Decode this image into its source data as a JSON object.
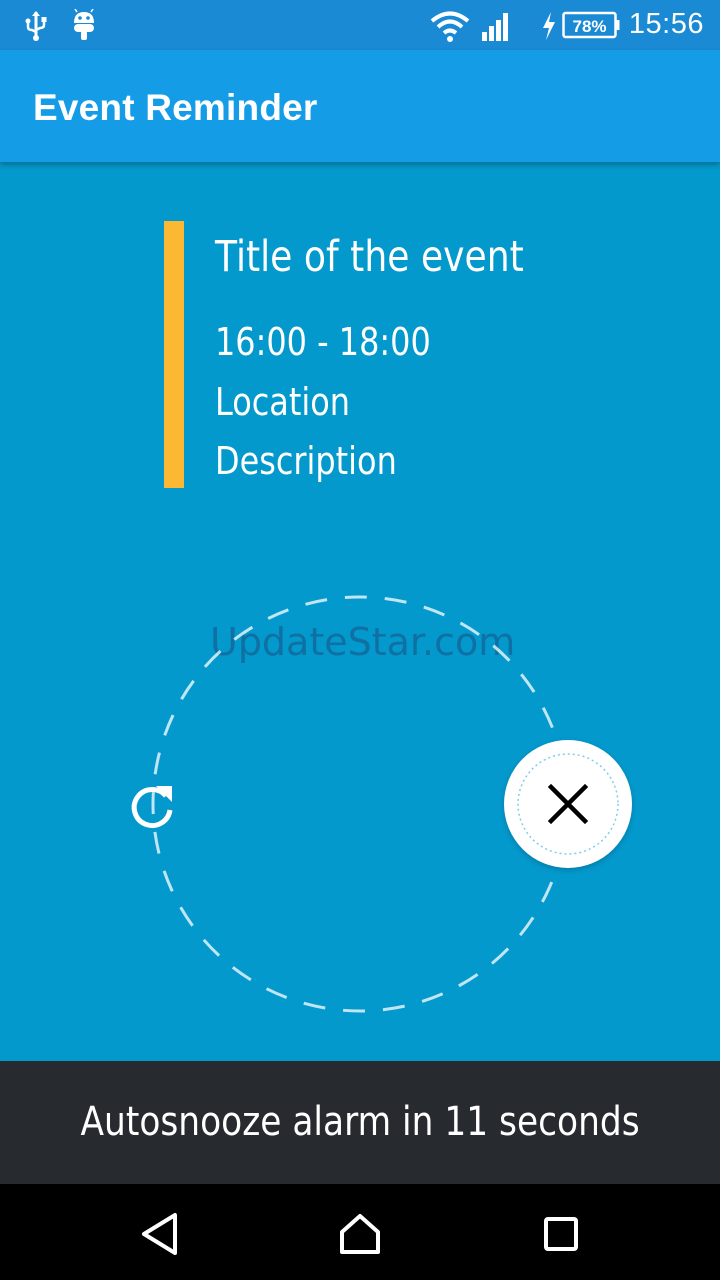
{
  "status_bar": {
    "time": "15:56",
    "battery": "78%",
    "icons": [
      "usb-icon",
      "android-debug-icon",
      "wifi-icon",
      "cell-signal-icon",
      "charging-icon",
      "battery-icon"
    ]
  },
  "app_bar": {
    "title": "Event Reminder"
  },
  "event": {
    "title": "Title of the event",
    "time": "16:00 - 18:00",
    "location": "Location",
    "description": "Description",
    "accent_color": "#fbb933"
  },
  "watermark": "UpdateStar.com",
  "dial": {
    "snooze_icon": "snooze-refresh-icon",
    "dismiss_icon": "close-icon"
  },
  "autosnooze": {
    "text": "Autosnooze alarm in 11 seconds"
  },
  "nav_bar": {
    "icons": [
      "back-icon",
      "home-icon",
      "recents-icon"
    ]
  },
  "colors": {
    "background": "#0499cd",
    "app_bar": "#149ce6",
    "status_bar": "#1a8ad4",
    "autosnooze_bar": "#272b2f"
  }
}
